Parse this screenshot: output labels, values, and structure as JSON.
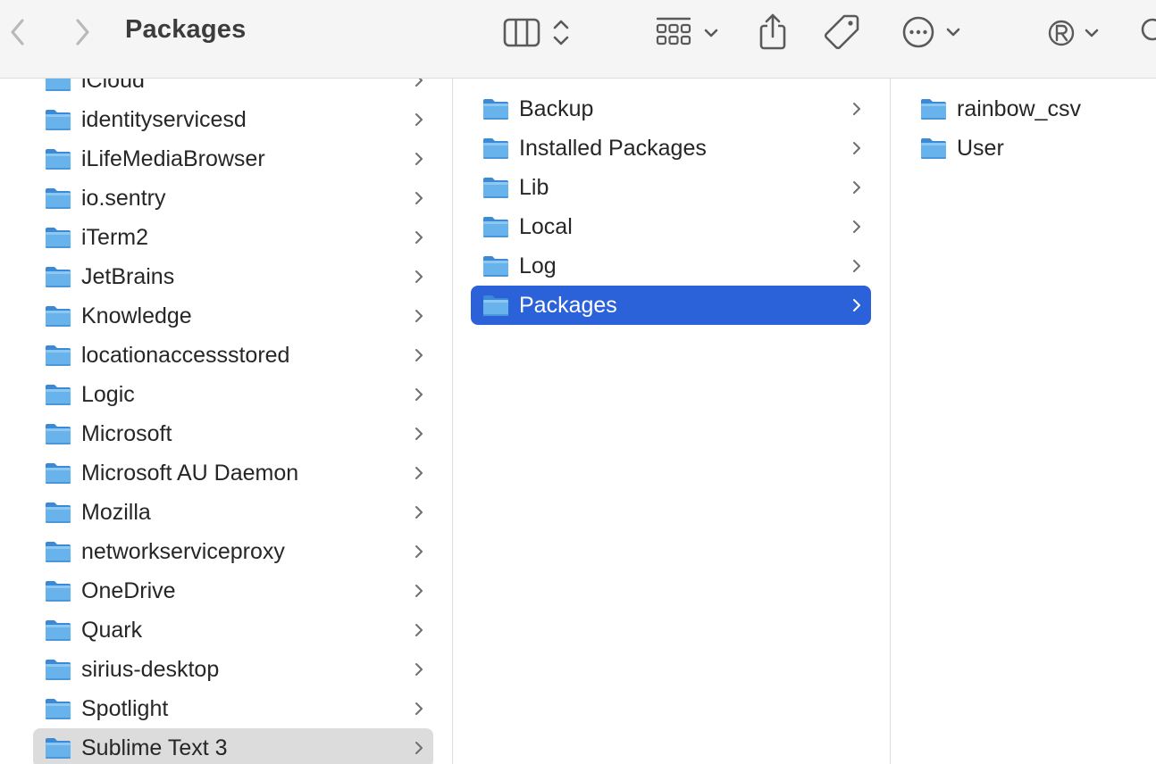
{
  "window": {
    "title": "Packages"
  },
  "toolbar": {
    "back_icon": "chevron-left-icon",
    "forward_icon": "chevron-right-icon",
    "view_icon": "column-view-icon",
    "group_icon": "icon-grid-group-icon",
    "share_icon": "share-icon",
    "tag_icon": "tag-icon",
    "more_icon": "ellipsis-circle-icon",
    "registered_icon": "registered-r-icon",
    "search_icon": "search-icon"
  },
  "colors": {
    "selection_active": "#2c62d9",
    "selection_inactive": "#dcdcdc",
    "folder_blue": "#5ea9e6"
  },
  "columns": [
    {
      "items": [
        {
          "label": "iCloud",
          "selected": ""
        },
        {
          "label": "identityservicesd",
          "selected": ""
        },
        {
          "label": "iLifeMediaBrowser",
          "selected": ""
        },
        {
          "label": "io.sentry",
          "selected": ""
        },
        {
          "label": "iTerm2",
          "selected": ""
        },
        {
          "label": "JetBrains",
          "selected": ""
        },
        {
          "label": "Knowledge",
          "selected": ""
        },
        {
          "label": "locationaccessstored",
          "selected": ""
        },
        {
          "label": "Logic",
          "selected": ""
        },
        {
          "label": "Microsoft",
          "selected": ""
        },
        {
          "label": "Microsoft AU Daemon",
          "selected": ""
        },
        {
          "label": "Mozilla",
          "selected": ""
        },
        {
          "label": "networkserviceproxy",
          "selected": ""
        },
        {
          "label": "OneDrive",
          "selected": ""
        },
        {
          "label": "Quark",
          "selected": ""
        },
        {
          "label": "sirius-desktop",
          "selected": ""
        },
        {
          "label": "Spotlight",
          "selected": ""
        },
        {
          "label": "Sublime Text 3",
          "selected": "inactive"
        }
      ]
    },
    {
      "items": [
        {
          "label": "Backup",
          "selected": ""
        },
        {
          "label": "Installed Packages",
          "selected": ""
        },
        {
          "label": "Lib",
          "selected": ""
        },
        {
          "label": "Local",
          "selected": ""
        },
        {
          "label": "Log",
          "selected": ""
        },
        {
          "label": "Packages",
          "selected": "active"
        }
      ]
    },
    {
      "items": [
        {
          "label": "rainbow_csv",
          "selected": ""
        },
        {
          "label": "User",
          "selected": ""
        }
      ]
    }
  ]
}
